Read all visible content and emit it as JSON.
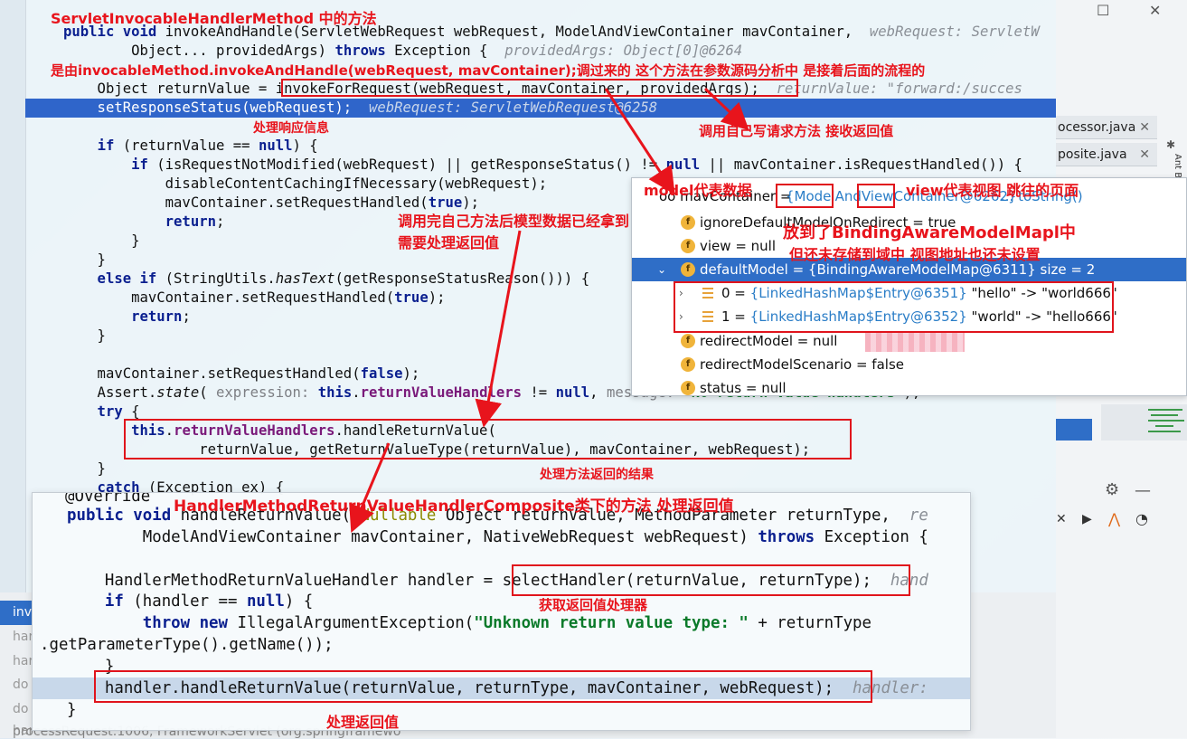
{
  "window": {
    "minimize": "—",
    "maximize": "☐",
    "close": "✕"
  },
  "code": {
    "l1a": "public void ",
    "l1b": "invokeAndHandle(ServletWebRequest webRequest, ModelAndViewContainer mavContainer,",
    "l1hint": "webRequest: ServletW",
    "l2a": "        Object... providedArgs) ",
    "l2kw": "throws",
    "l2b": " Exception {",
    "l2hint": "providedArgs: Object[0]@6264",
    "l4": "    Object returnValue = invokeForRequest(webRequest, mavContainer, providedArgs);",
    "l4hint": "returnValue: \"forward:/succes",
    "l5": "    setResponseStatus(webRequest);",
    "l5hint": "webRequest: ServletWebRequest@6258",
    "l7a": "    ",
    "l7kw": "if",
    "l7b": " (returnValue == ",
    "l7null": "null",
    "l7c": ") {",
    "l8a": "        ",
    "l8kw": "if",
    "l8b": " (isRequestNotModified(webRequest) || getResponseStatus() != ",
    "l8null": "null",
    "l8c": " || mavContainer.isRequestHandled()) {",
    "l9": "            disableContentCachingIfNecessary(webRequest);",
    "l10a": "            mavContainer.setRequestHandled(",
    "l10kw": "true",
    "l10b": ");",
    "l11kw": "            return",
    "l11b": ";",
    "l12": "        }",
    "l13": "    }",
    "l14kw": "    else if",
    "l14b": " (StringUtils.",
    "l14i": "hasText",
    "l14c": "(getResponseStatusReason())) {",
    "l15a": "        mavContainer.setRequestHandled(",
    "l15kw": "true",
    "l15b": ");",
    "l16kw": "        return",
    "l16b": ";",
    "l17": "    }",
    "l19a": "    mavContainer.setRequestHandled(",
    "l19kw": "false",
    "l19b": ");",
    "l20a": "    Assert.",
    "l20i": "state",
    "l20b": "( ",
    "l20p": "expression:",
    "l20c": " ",
    "l20this": "this",
    "l20d": ".",
    "l20f": "returnValueHandlers",
    "l20e": " != ",
    "l20null": "null",
    "l20g": ", ",
    "l20p2": "message:",
    "l20s": " \"No return value handlers\"",
    "l20h": ");",
    "l21kw": "    try",
    "l21b": " {",
    "l22a": "        ",
    "l22this": "this",
    "l22d": ".",
    "l22f": "returnValueHandlers",
    "l22b": ".handleReturnValue(",
    "l23": "                returnValue, getReturnValueType(returnValue), mavContainer, webRequest);",
    "l24": "    }",
    "l25kw": "    catch",
    "l25b": " (Exception ex) {"
  },
  "vars": {
    "mav_a": "oo mavContainer = ",
    "mav_b": "{ModelAndViewContainer@6262}",
    "mav_c": " ... toString()",
    "r1n": "ignoreDefaultModelOnRedirect",
    "r1v": " = true",
    "r2n": "view",
    "r2v": " = null",
    "r3n": "defaultModel",
    "r3v": " = {BindingAwareModelMap@6311}  size = 2",
    "r4a": "0 = ",
    "r4b": "{LinkedHashMap$Entry@6351}",
    "r4c": " \"hello\" -> \"world666\"",
    "r5a": "1 = ",
    "r5b": "{LinkedHashMap$Entry@6352}",
    "r5c": " \"world\" -> \"hello666\"",
    "r6n": "redirectModel",
    "r6v": " = null",
    "r7n": "redirectModelScenario",
    "r7v": " = false",
    "r8n": "status",
    "r8v": " = null"
  },
  "popup": {
    "p0": "@Override",
    "p1kw": "public void",
    "p1a": " handleReturnValue(",
    "p1ann": "@Nullable",
    "p1b": " Object returnValue, MethodParameter returnType,",
    "p1hint": "re",
    "p2a": "        ModelAndViewContainer mavContainer, NativeWebRequest webRequest) ",
    "p2kw": "throws",
    "p2b": " Exception {",
    "p4a": "    HandlerMethodReturnValueHandler handler = selectHandler(returnValue, returnType);",
    "p4hint": "hand",
    "p5kw": "    if",
    "p5a": " (handler == ",
    "p5null": "null",
    "p5b": ") {",
    "p6kw": "        throw new",
    "p6a": " IllegalArgumentException(",
    "p6s": "\"Unknown return value type: \"",
    "p6b": " + returnType",
    "p7": ".getParameterType().getName());",
    "p8": "    }",
    "p9": "    handler.handleReturnValue(returnValue, returnType, mavContainer, webRequest);",
    "p9hint": "handler:",
    "p10": "}"
  },
  "tabs": [
    {
      "label": "ocessor.java",
      "close": "✕"
    },
    {
      "label": "posite.java",
      "close": "✕"
    }
  ],
  "side": {
    "frames_label": "inv",
    "items": [
      "har",
      "har",
      "do",
      "do",
      "har"
    ],
    "status": "processRequest:1006, FrameworkServlet (org.springframewo"
  },
  "annotations": {
    "a1": "ServletInvocableHandlerMethod 中的方法",
    "a2": "是由invocableMethod.invokeAndHandle(webRequest, mavContainer);调过来的 这个方法在参数源码分析中  是接着后面的流程的",
    "a3": "处理响应信息",
    "a4": "调用自己写请求方法  接收返回值",
    "a5": "model代表数据",
    "a6": "view代表视图 跳往的页面",
    "a7": "放到了BindingAwareModelMapl中",
    "a8": "但还未存储到域中  视图地址也还未设置",
    "a9": "调用完自己方法后模型数据已经拿到",
    "a10": "需要处理返回值",
    "a11": "处理方法返回的结果",
    "a12": "HandlerMethodReturnValueHandlerComposite类下的方法  处理返回值",
    "a13": "获取返回值处理器",
    "a14": "处理返回值"
  }
}
